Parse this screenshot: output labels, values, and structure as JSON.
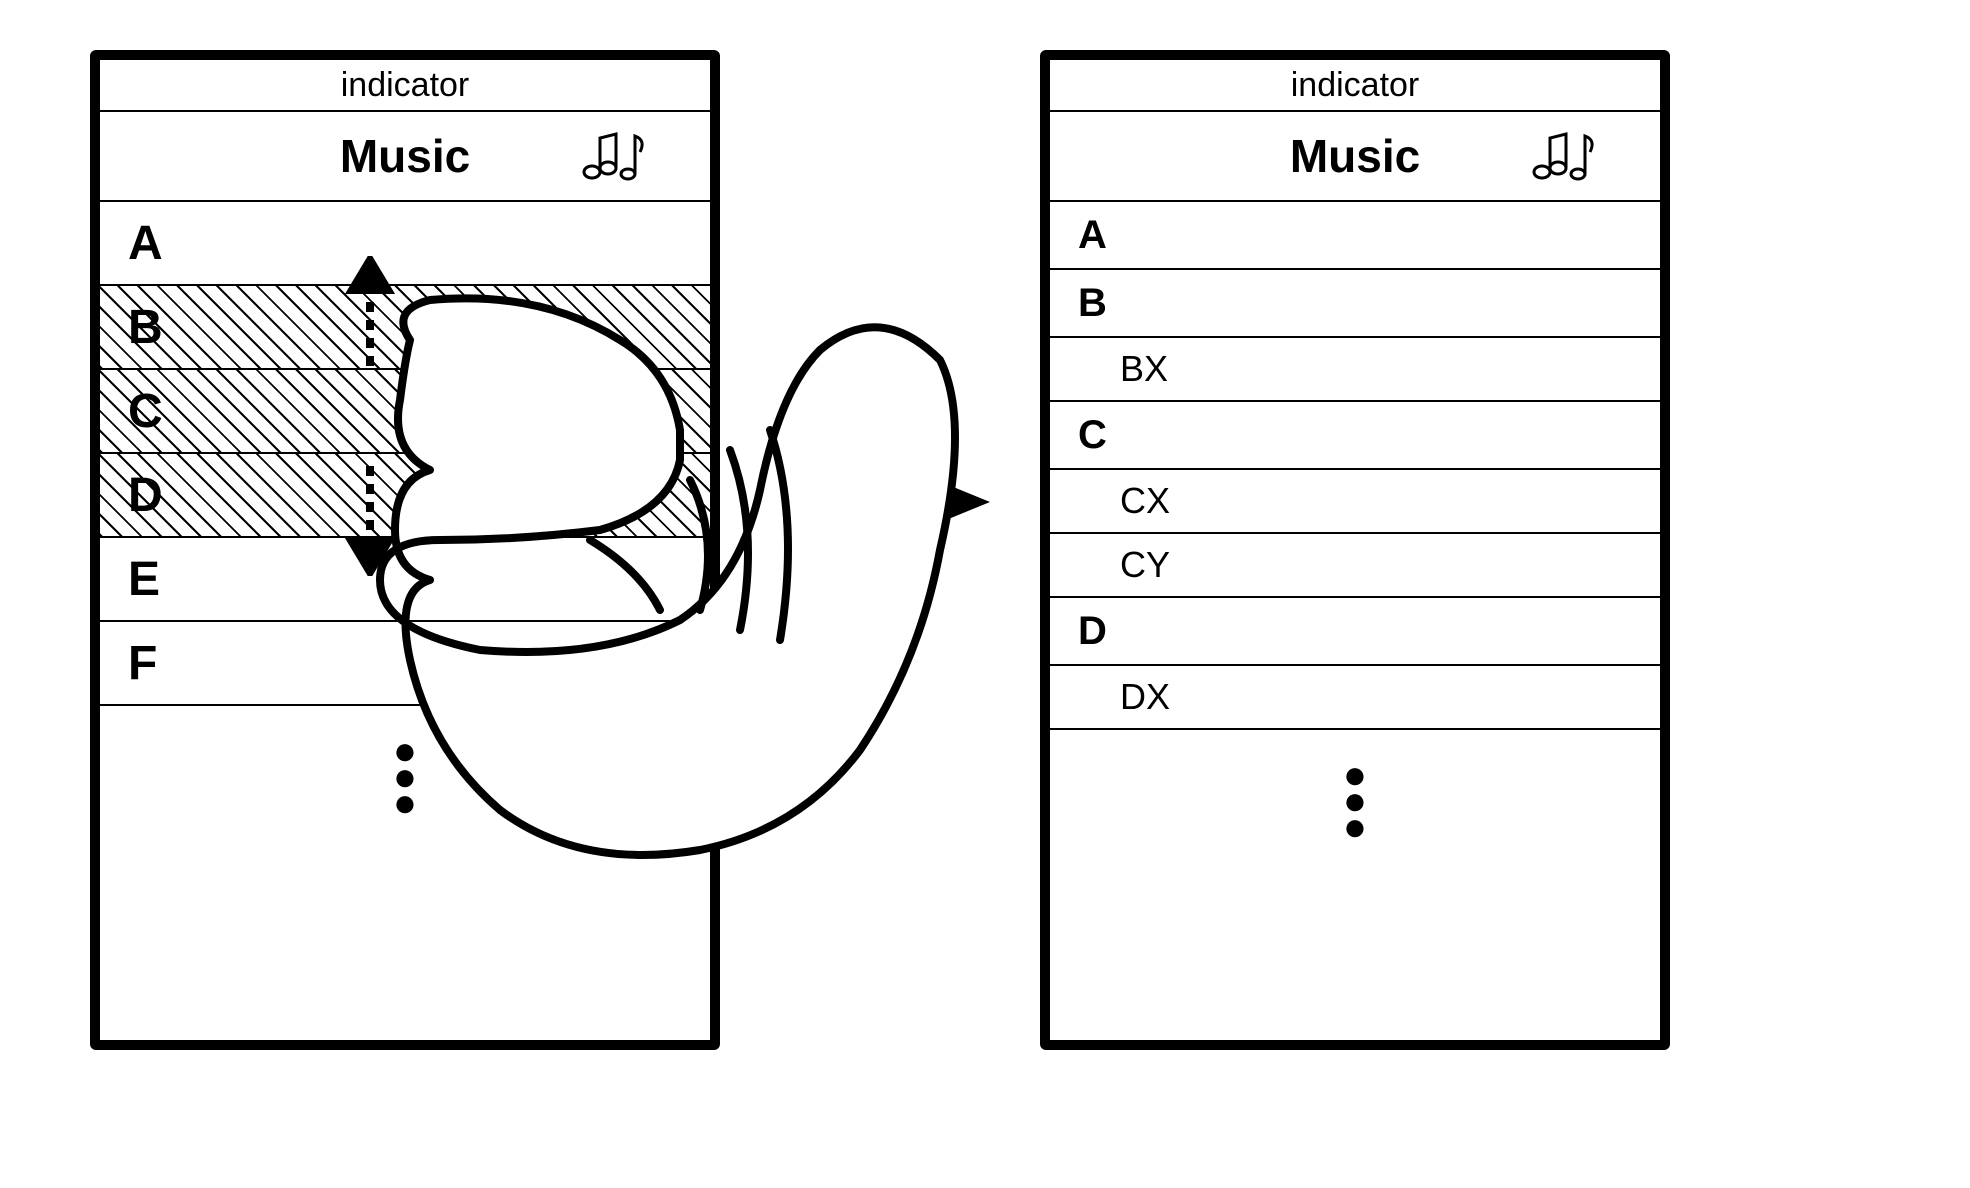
{
  "indicator_label": "indicator",
  "title_label": "Music",
  "left_panel": {
    "items": [
      {
        "label": "A",
        "hatched": false
      },
      {
        "label": "B",
        "hatched": true
      },
      {
        "label": "C",
        "hatched": true
      },
      {
        "label": "D",
        "hatched": true
      },
      {
        "label": "E",
        "hatched": false
      },
      {
        "label": "F",
        "hatched": false
      }
    ]
  },
  "right_panel": {
    "items": [
      {
        "label": "A",
        "indent": 0
      },
      {
        "label": "B",
        "indent": 0
      },
      {
        "label": "BX",
        "indent": 1
      },
      {
        "label": "C",
        "indent": 0
      },
      {
        "label": "CX",
        "indent": 1
      },
      {
        "label": "CY",
        "indent": 1
      },
      {
        "label": "D",
        "indent": 0
      },
      {
        "label": "DX",
        "indent": 1
      }
    ]
  },
  "gesture": "pinch-out",
  "transition": "expand"
}
